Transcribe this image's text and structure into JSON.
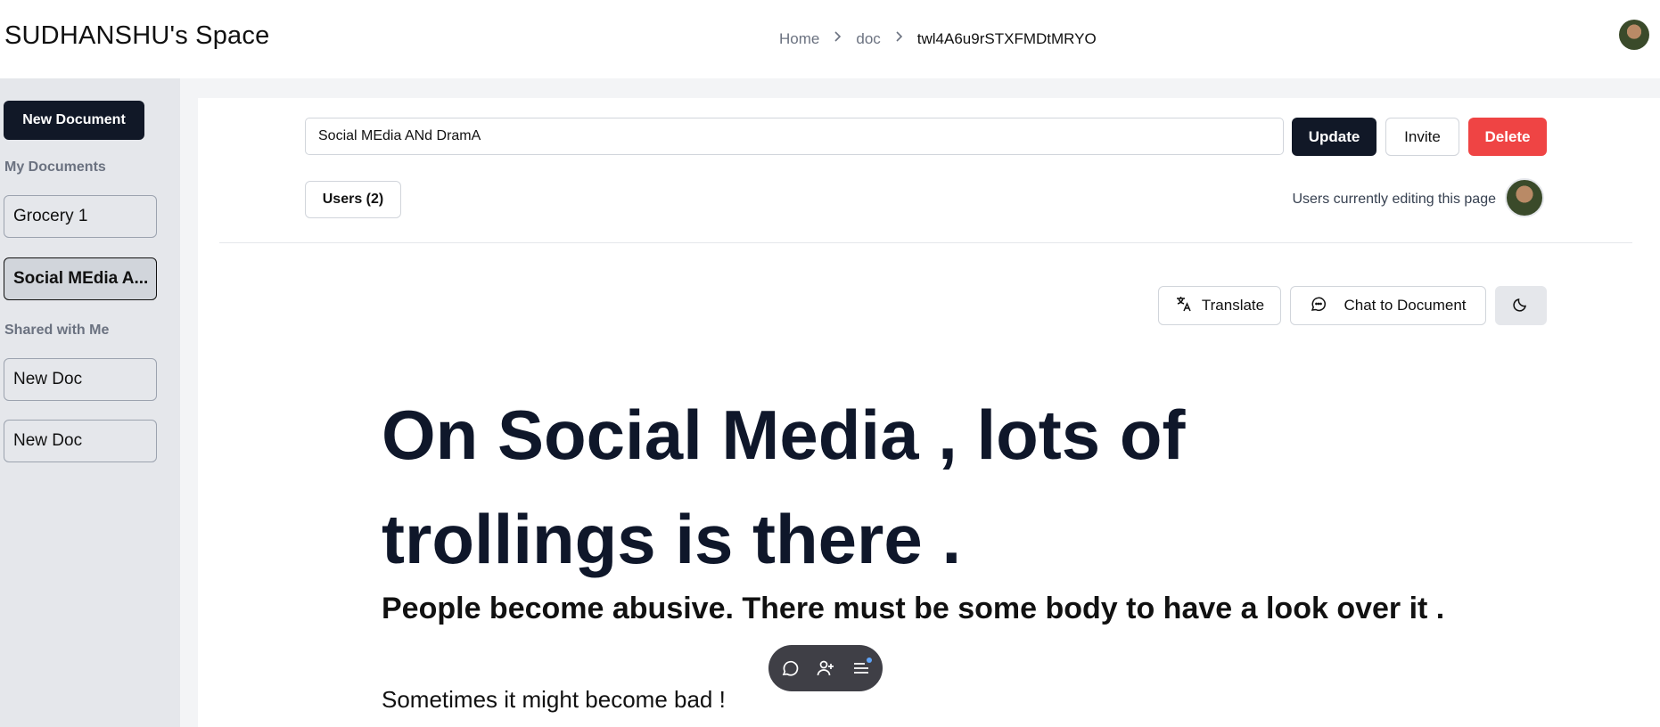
{
  "header": {
    "app_title": "SUDHANSHU's Space",
    "breadcrumb": [
      "Home",
      "doc",
      "twl4A6u9rSTXFMDtMRYO"
    ]
  },
  "sidebar": {
    "new_document_label": "New Document",
    "my_documents_label": "My Documents",
    "my_documents": [
      "Grocery 1",
      "Social MEdia A..."
    ],
    "shared_label": "Shared with Me",
    "shared_documents": [
      "New Doc",
      "New Doc"
    ]
  },
  "editor": {
    "title_value": "Social MEdia ANd DramA",
    "update_label": "Update",
    "invite_label": "Invite",
    "delete_label": "Delete",
    "users_label": "Users (2)",
    "editing_label": "Users currently editing this page",
    "translate_label": "Translate",
    "chat_label": "Chat to Document"
  },
  "content": {
    "heading": "On Social Media , lots of trollings is there .",
    "subheading": "People become abusive. There must be some body to have a look over it .",
    "paragraph": "Sometimes it might become bad !"
  },
  "colors": {
    "delete": "#ef4444",
    "primary": "#111827",
    "sidebar_bg": "#e5e7eb"
  }
}
